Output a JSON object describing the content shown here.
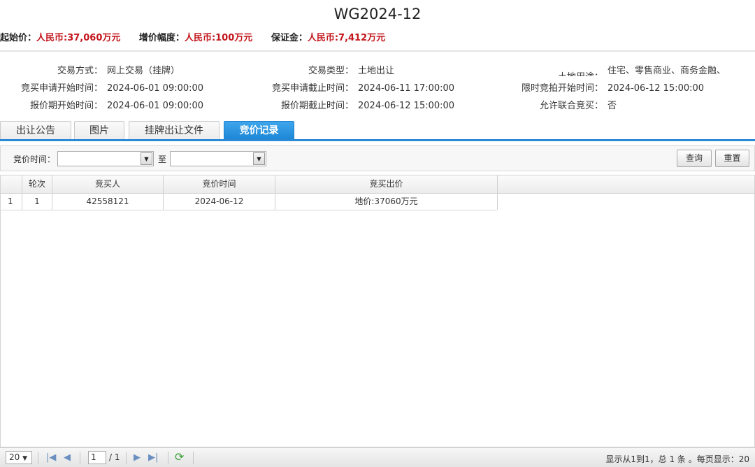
{
  "title": "WG2024-12",
  "prices": {
    "start_label": "起始价：",
    "start_value": "人民币:37,060万元",
    "step_label": "增价幅度：",
    "step_value": "人民币:100万元",
    "deposit_label": "保证金：",
    "deposit_value": "人民币:7,412万元"
  },
  "info": {
    "trade_mode_label": "交易方式：",
    "trade_mode_value": "网上交易（挂牌）",
    "trade_type_label": "交易类型：",
    "trade_type_value": "土地出让",
    "land_use_label": "土地用途：",
    "land_use_value": "住宅、零售商业、商务金融、",
    "apply_start_label": "竞买申请开始时间：",
    "apply_start_value": "2024-06-01 09:00:00",
    "apply_end_label": "竞买申请截止时间：",
    "apply_end_value": "2024-06-11 17:00:00",
    "auction_start_label": "限时竞拍开始时间：",
    "auction_start_value": "2024-06-12 15:00:00",
    "quote_start_label": "报价期开始时间：",
    "quote_start_value": "2024-06-01 09:00:00",
    "quote_end_label": "报价期截止时间：",
    "quote_end_value": "2024-06-12 15:00:00",
    "joint_label": "允许联合竞买：",
    "joint_value": "否"
  },
  "tabs": [
    "出让公告",
    "图片",
    "挂牌出让文件",
    "竞价记录"
  ],
  "active_tab": 3,
  "filter": {
    "time_label": "竞价时间：",
    "to_label": "至",
    "from_value": "",
    "to_value": "",
    "query_button": "查询",
    "reset_button": "重置"
  },
  "grid": {
    "columns": [
      "轮次",
      "竞买人",
      "竞价时间",
      "竞买出价"
    ],
    "rows": [
      {
        "index": "1",
        "round": "1",
        "bidder": "42558121",
        "time": "2024-06-12",
        "price": "地价:37060万元"
      }
    ]
  },
  "pager": {
    "page_size": "20",
    "current_page": "1",
    "total_pages": "/ 1",
    "summary": "显示从1到1，总 1 条 。每页显示：20"
  }
}
